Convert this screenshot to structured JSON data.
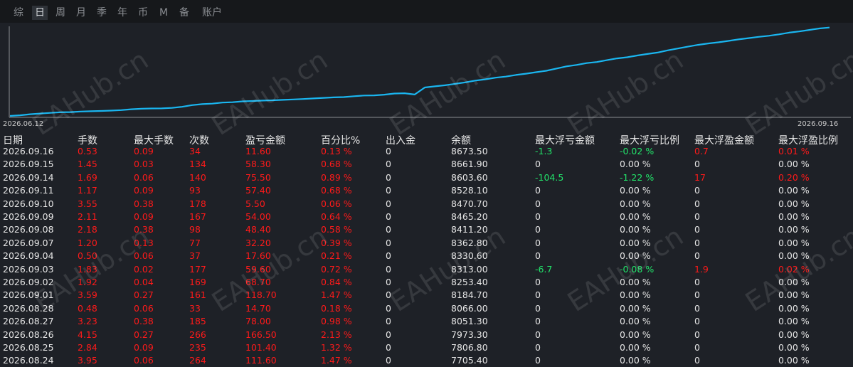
{
  "tabs": [
    {
      "label": "综",
      "active": false
    },
    {
      "label": "日",
      "active": true
    },
    {
      "label": "周",
      "active": false
    },
    {
      "label": "月",
      "active": false
    },
    {
      "label": "季",
      "active": false
    },
    {
      "label": "年",
      "active": false
    },
    {
      "label": "币",
      "active": false
    },
    {
      "label": "M",
      "active": false
    },
    {
      "label": "备",
      "active": false
    },
    {
      "label": "账户",
      "active": false
    }
  ],
  "watermark": "EAHub.cn",
  "colors": {
    "line": "#1ab6f0",
    "profit": "#ff1a1a",
    "loss": "#22e36a",
    "background": "#1e2127"
  },
  "chart_data": {
    "type": "line",
    "x_start_label": "2026.06.12",
    "x_end_label": "2026.09.16",
    "series": [
      {
        "values": [
          7460,
          7468,
          7483,
          7493,
          7502,
          7510,
          7512,
          7520,
          7524,
          7528,
          7533,
          7540,
          7551,
          7558,
          7562,
          7563,
          7570,
          7585,
          7608,
          7622,
          7628,
          7643,
          7648,
          7660,
          7665,
          7670,
          7674,
          7680,
          7686,
          7692,
          7700,
          7708,
          7714,
          7718,
          7730,
          7740,
          7742,
          7752,
          7767,
          7771,
          7753,
          7850,
          7866,
          7880,
          7900,
          7920,
          7945,
          7962,
          7985,
          8000,
          8022,
          8040,
          8060,
          8080,
          8110,
          8140,
          8160,
          8185,
          8200,
          8225,
          8250,
          8265,
          8290,
          8310,
          8330,
          8360,
          8385,
          8411,
          8435,
          8455,
          8470,
          8490,
          8510,
          8528,
          8545,
          8560,
          8580,
          8603,
          8620,
          8640,
          8661,
          8673
        ]
      }
    ]
  },
  "table": {
    "headers": [
      "日期",
      "手数",
      "最大手数",
      "次数",
      "盈亏金额",
      "百分比%",
      "出入金",
      "余额",
      "最大浮亏金额",
      "最大浮亏比例",
      "最大浮盈金额",
      "最大浮盈比例"
    ],
    "rows": [
      {
        "date": "2026.09.16",
        "lots": "0.53",
        "max_lots": "0.09",
        "count": "34",
        "pnl": "11.60",
        "pct": "0.13 %",
        "io": "0",
        "balance": "8673.50",
        "fl_amt": "-1.3",
        "fl_pct": "-0.02 %",
        "fp_amt": "0.7",
        "fp_pct": "0.01 %"
      },
      {
        "date": "2026.09.15",
        "lots": "1.45",
        "max_lots": "0.03",
        "count": "134",
        "pnl": "58.30",
        "pct": "0.68 %",
        "io": "0",
        "balance": "8661.90",
        "fl_amt": "0",
        "fl_pct": "0.00 %",
        "fp_amt": "0",
        "fp_pct": "0.00 %"
      },
      {
        "date": "2026.09.14",
        "lots": "1.69",
        "max_lots": "0.06",
        "count": "140",
        "pnl": "75.50",
        "pct": "0.89 %",
        "io": "0",
        "balance": "8603.60",
        "fl_amt": "-104.5",
        "fl_pct": "-1.22 %",
        "fp_amt": "17",
        "fp_pct": "0.20 %"
      },
      {
        "date": "2026.09.11",
        "lots": "1.17",
        "max_lots": "0.09",
        "count": "93",
        "pnl": "57.40",
        "pct": "0.68 %",
        "io": "0",
        "balance": "8528.10",
        "fl_amt": "0",
        "fl_pct": "0.00 %",
        "fp_amt": "0",
        "fp_pct": "0.00 %"
      },
      {
        "date": "2026.09.10",
        "lots": "3.55",
        "max_lots": "0.38",
        "count": "178",
        "pnl": "5.50",
        "pct": "0.06 %",
        "io": "0",
        "balance": "8470.70",
        "fl_amt": "0",
        "fl_pct": "0.00 %",
        "fp_amt": "0",
        "fp_pct": "0.00 %"
      },
      {
        "date": "2026.09.09",
        "lots": "2.11",
        "max_lots": "0.09",
        "count": "167",
        "pnl": "54.00",
        "pct": "0.64 %",
        "io": "0",
        "balance": "8465.20",
        "fl_amt": "0",
        "fl_pct": "0.00 %",
        "fp_amt": "0",
        "fp_pct": "0.00 %"
      },
      {
        "date": "2026.09.08",
        "lots": "2.18",
        "max_lots": "0.38",
        "count": "98",
        "pnl": "48.40",
        "pct": "0.58 %",
        "io": "0",
        "balance": "8411.20",
        "fl_amt": "0",
        "fl_pct": "0.00 %",
        "fp_amt": "0",
        "fp_pct": "0.00 %"
      },
      {
        "date": "2026.09.07",
        "lots": "1.20",
        "max_lots": "0.13",
        "count": "77",
        "pnl": "32.20",
        "pct": "0.39 %",
        "io": "0",
        "balance": "8362.80",
        "fl_amt": "0",
        "fl_pct": "0.00 %",
        "fp_amt": "0",
        "fp_pct": "0.00 %"
      },
      {
        "date": "2026.09.04",
        "lots": "0.50",
        "max_lots": "0.06",
        "count": "37",
        "pnl": "17.60",
        "pct": "0.21 %",
        "io": "0",
        "balance": "8330.60",
        "fl_amt": "0",
        "fl_pct": "0.00 %",
        "fp_amt": "0",
        "fp_pct": "0.00 %"
      },
      {
        "date": "2026.09.03",
        "lots": "1.83",
        "max_lots": "0.02",
        "count": "177",
        "pnl": "59.60",
        "pct": "0.72 %",
        "io": "0",
        "balance": "8313.00",
        "fl_amt": "-6.7",
        "fl_pct": "-0.08 %",
        "fp_amt": "1.9",
        "fp_pct": "0.02 %"
      },
      {
        "date": "2026.09.02",
        "lots": "1.92",
        "max_lots": "0.04",
        "count": "169",
        "pnl": "68.70",
        "pct": "0.84 %",
        "io": "0",
        "balance": "8253.40",
        "fl_amt": "0",
        "fl_pct": "0.00 %",
        "fp_amt": "0",
        "fp_pct": "0.00 %"
      },
      {
        "date": "2026.09.01",
        "lots": "3.59",
        "max_lots": "0.27",
        "count": "161",
        "pnl": "118.70",
        "pct": "1.47 %",
        "io": "0",
        "balance": "8184.70",
        "fl_amt": "0",
        "fl_pct": "0.00 %",
        "fp_amt": "0",
        "fp_pct": "0.00 %"
      },
      {
        "date": "2026.08.28",
        "lots": "0.48",
        "max_lots": "0.06",
        "count": "33",
        "pnl": "14.70",
        "pct": "0.18 %",
        "io": "0",
        "balance": "8066.00",
        "fl_amt": "0",
        "fl_pct": "0.00 %",
        "fp_amt": "0",
        "fp_pct": "0.00 %"
      },
      {
        "date": "2026.08.27",
        "lots": "3.23",
        "max_lots": "0.38",
        "count": "185",
        "pnl": "78.00",
        "pct": "0.98 %",
        "io": "0",
        "balance": "8051.30",
        "fl_amt": "0",
        "fl_pct": "0.00 %",
        "fp_amt": "0",
        "fp_pct": "0.00 %"
      },
      {
        "date": "2026.08.26",
        "lots": "4.15",
        "max_lots": "0.27",
        "count": "266",
        "pnl": "166.50",
        "pct": "2.13 %",
        "io": "0",
        "balance": "7973.30",
        "fl_amt": "0",
        "fl_pct": "0.00 %",
        "fp_amt": "0",
        "fp_pct": "0.00 %"
      },
      {
        "date": "2026.08.25",
        "lots": "2.84",
        "max_lots": "0.09",
        "count": "235",
        "pnl": "101.40",
        "pct": "1.32 %",
        "io": "0",
        "balance": "7806.80",
        "fl_amt": "0",
        "fl_pct": "0.00 %",
        "fp_amt": "0",
        "fp_pct": "0.00 %"
      },
      {
        "date": "2026.08.24",
        "lots": "3.95",
        "max_lots": "0.06",
        "count": "264",
        "pnl": "111.60",
        "pct": "1.47 %",
        "io": "0",
        "balance": "7705.40",
        "fl_amt": "0",
        "fl_pct": "0.00 %",
        "fp_amt": "0",
        "fp_pct": "0.00 %"
      }
    ]
  }
}
